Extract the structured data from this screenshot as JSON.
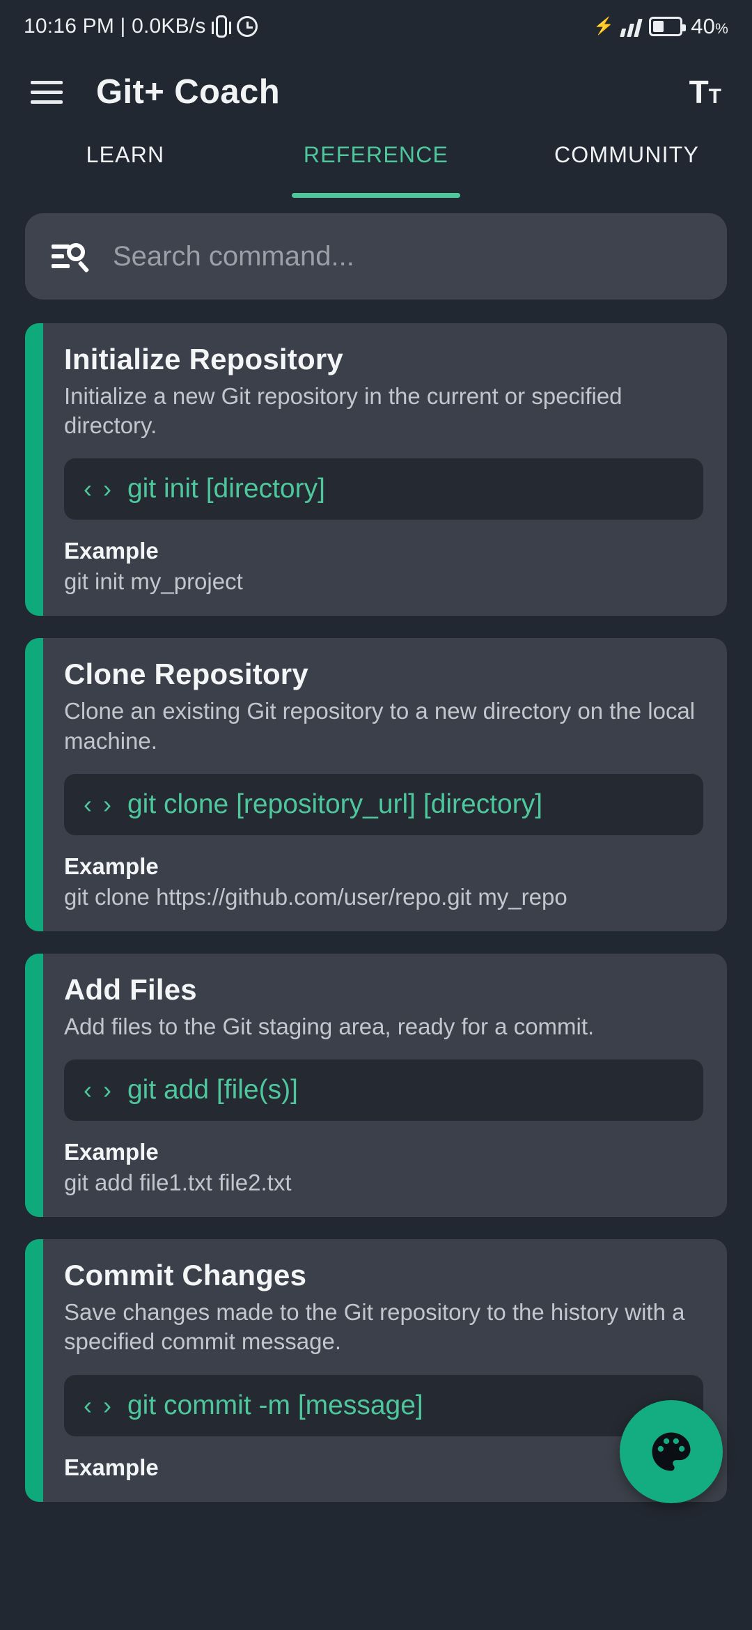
{
  "statusbar": {
    "time_network": "10:16 PM | 0.0KB/s",
    "battery_level": "40",
    "battery_unit": "%",
    "vibrate_icon": "vibrate-icon",
    "clock_icon": "clock-icon",
    "charging_icon": "bolt-icon",
    "signal_icon": "signal-bars-icon",
    "battery_icon": "battery-icon"
  },
  "appbar": {
    "menu_icon": "hamburger-menu-icon",
    "title": "Git+ Coach",
    "textsize_big": "T",
    "textsize_small": "T",
    "textsize_icon": "text-size-icon"
  },
  "tabs": [
    {
      "label": "LEARN",
      "active": false
    },
    {
      "label": "REFERENCE",
      "active": true
    },
    {
      "label": "COMMUNITY",
      "active": false
    }
  ],
  "search": {
    "placeholder": "Search command...",
    "value": "",
    "icon": "manage-search-icon"
  },
  "commands": [
    {
      "title": "Initialize Repository",
      "description": "Initialize a new Git repository in the current or specified directory.",
      "command": "git init [directory]",
      "example_label": "Example",
      "example": "git init my_project"
    },
    {
      "title": "Clone Repository",
      "description": "Clone an existing Git repository to a new directory on the local machine.",
      "command": "git clone [repository_url] [directory]",
      "example_label": "Example",
      "example": "git clone https://github.com/user/repo.git my_repo"
    },
    {
      "title": "Add Files",
      "description": "Add files to the Git staging area, ready for a commit.",
      "command": "git add [file(s)]",
      "example_label": "Example",
      "example": "git add file1.txt file2.txt"
    },
    {
      "title": "Commit Changes",
      "description": "Save changes made to the Git repository to the history with a specified commit message.",
      "command": "git commit -m [message]",
      "example_label": "Example",
      "example": ""
    }
  ],
  "code_icon_glyph": "‹ ›",
  "fab": {
    "icon": "palette-icon"
  },
  "colors": {
    "page_background": "#222831",
    "card_background": "#3c404a",
    "code_background": "#242932",
    "accent_green": "#0faa7c",
    "accent_text_green": "#4ec79c",
    "fab_green": "#13ad81",
    "primary_text": "#f3f5f7",
    "secondary_text": "#c2c7cd",
    "placeholder_text": "#9aa0a8"
  }
}
